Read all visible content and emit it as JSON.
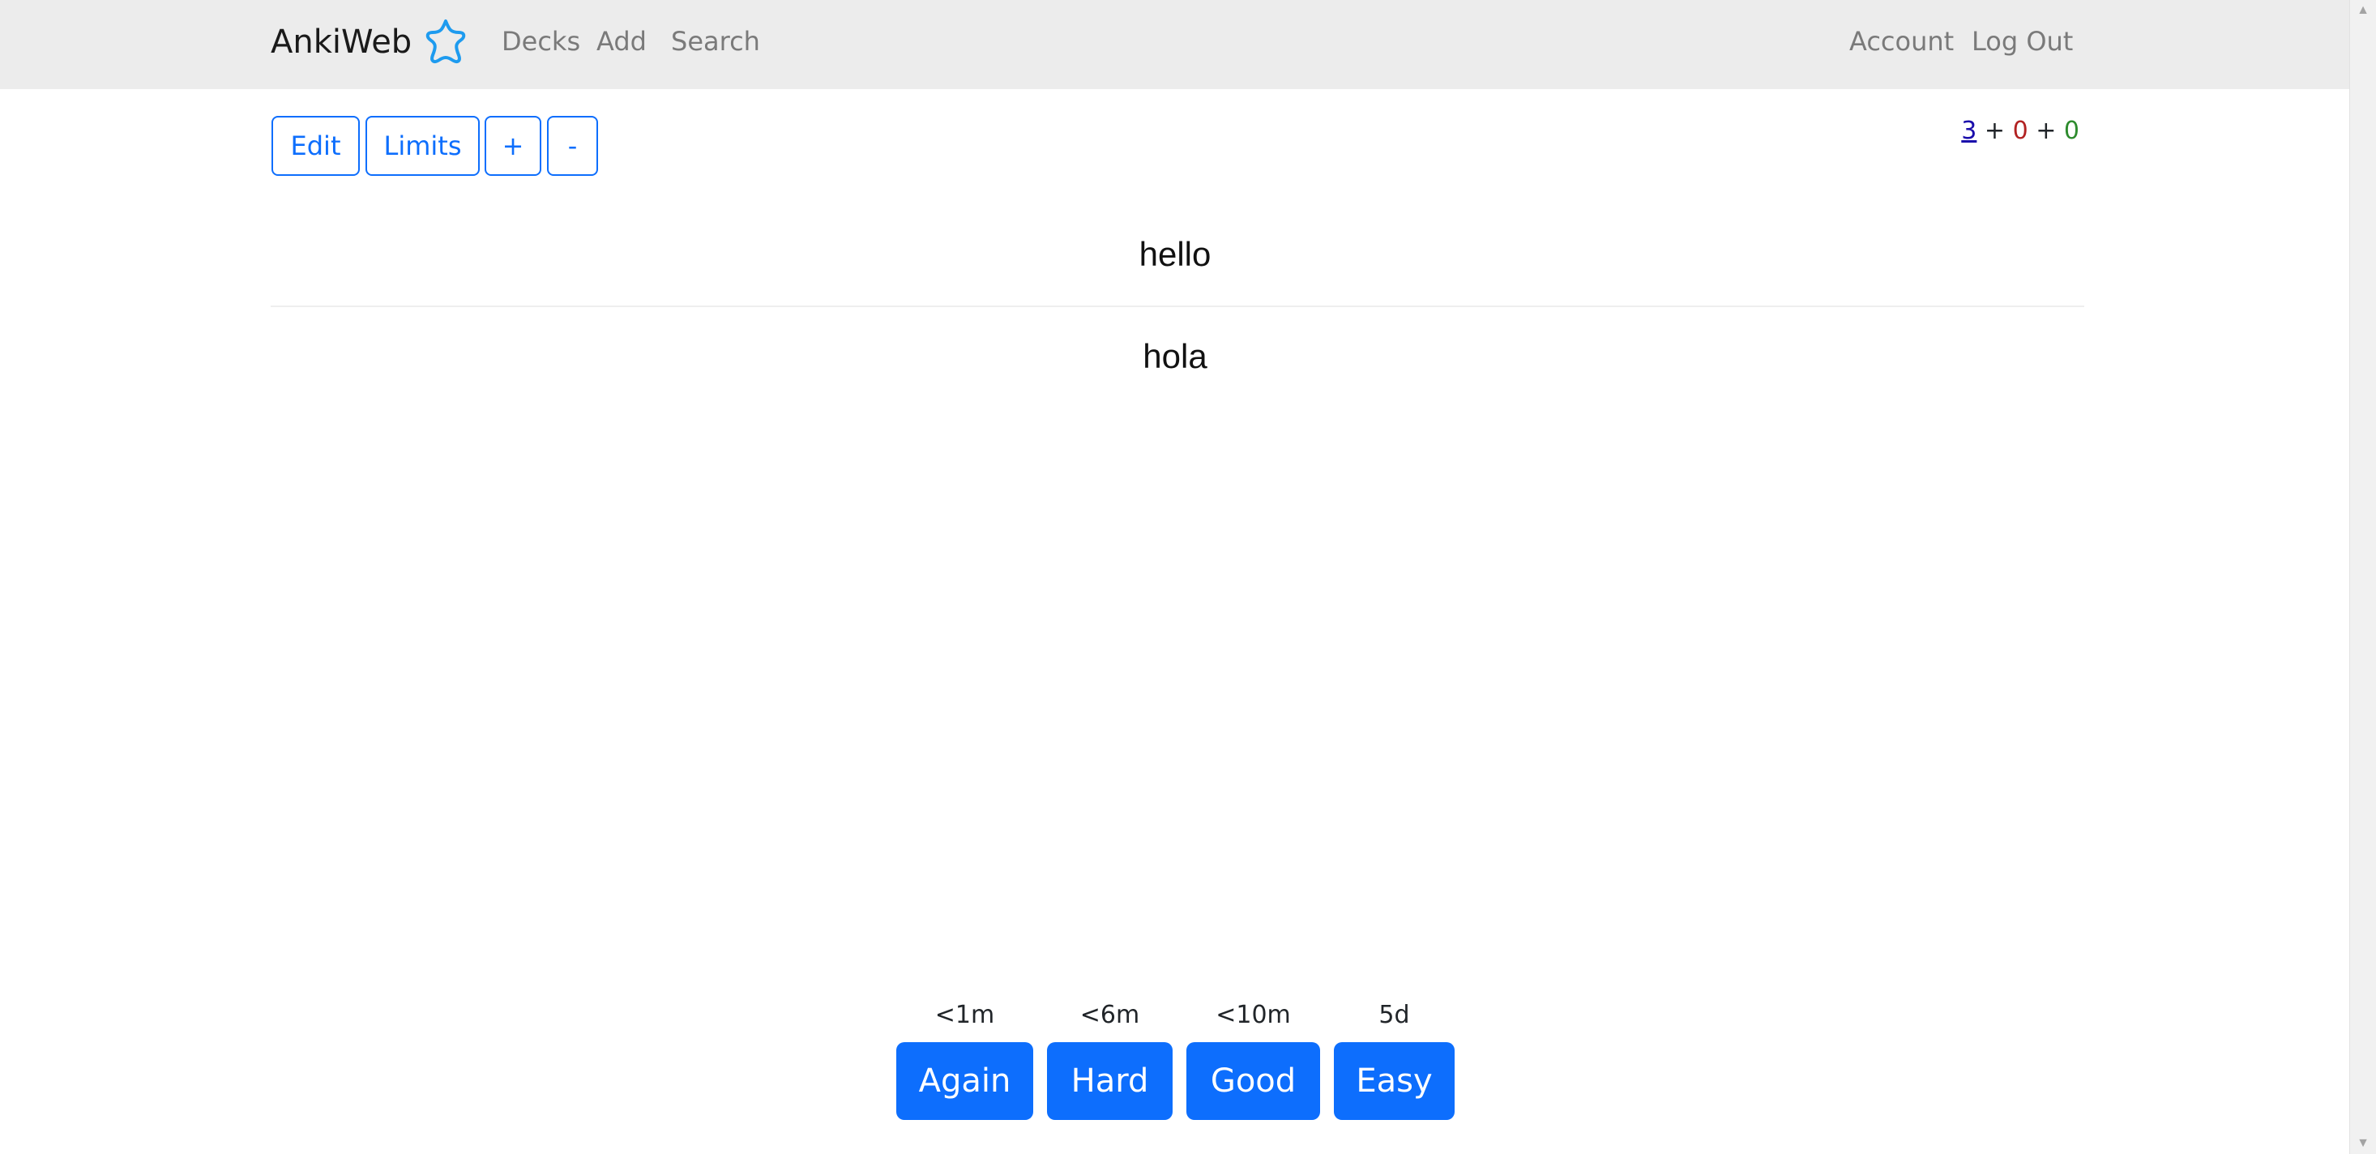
{
  "navbar": {
    "brand": "AnkiWeb",
    "links": [
      "Decks",
      "Add",
      "Search"
    ],
    "account": "Account",
    "logout": "Log Out",
    "brand_color": "#1e9bef"
  },
  "toolbar": {
    "edit": "Edit",
    "limits": "Limits",
    "plus": "+",
    "minus": "-"
  },
  "counts": {
    "new": "3",
    "sep1": " + ",
    "learn": "0",
    "sep2": " + ",
    "review": "0"
  },
  "card": {
    "front": "hello",
    "back": "hola"
  },
  "answers": [
    {
      "interval": "<1m",
      "label": "Again"
    },
    {
      "interval": "<6m",
      "label": "Hard"
    },
    {
      "interval": "<10m",
      "label": "Good"
    },
    {
      "interval": "5d",
      "label": "Easy"
    }
  ],
  "colors": {
    "primary": "#0d6efd",
    "navbar_bg": "#ececec",
    "count_new": "#1a0dab",
    "count_learn": "#b22222",
    "count_review": "#2e8b2e"
  }
}
